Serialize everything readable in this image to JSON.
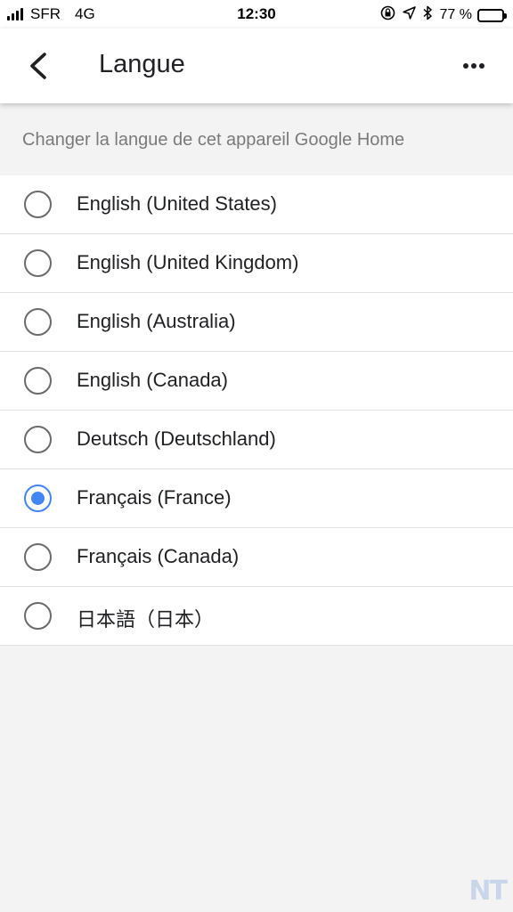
{
  "status_bar": {
    "carrier": "SFR",
    "network": "4G",
    "time": "12:30",
    "battery": "77 %",
    "battery_level": 0.77,
    "icons": [
      "rotation-lock-icon",
      "location-arrow-icon",
      "bluetooth-icon"
    ]
  },
  "header": {
    "title": "Langue",
    "back_icon": "chevron-left-icon",
    "more_icon": "more-horizontal-icon"
  },
  "subtitle": "Changer la langue de cet appareil Google Home",
  "languages": [
    {
      "label": "English (United States)",
      "selected": false
    },
    {
      "label": "English (United Kingdom)",
      "selected": false
    },
    {
      "label": "English (Australia)",
      "selected": false
    },
    {
      "label": "English (Canada)",
      "selected": false
    },
    {
      "label": "Deutsch (Deutschland)",
      "selected": false
    },
    {
      "label": "Français (France)",
      "selected": true
    },
    {
      "label": "Français (Canada)",
      "selected": false
    },
    {
      "label": "日本語（日本）",
      "selected": false
    }
  ],
  "colors": {
    "accent": "#4285f4",
    "background": "#f3f3f3"
  },
  "watermark": "NT"
}
